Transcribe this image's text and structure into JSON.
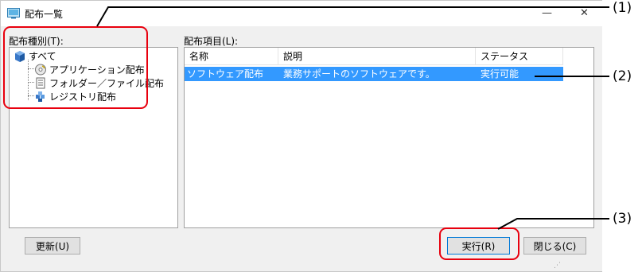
{
  "window": {
    "title": "配布一覧",
    "minimize_glyph": "—",
    "close_glyph": "✕"
  },
  "left_panel": {
    "label": "配布種別(T):",
    "tree": [
      {
        "label": "すべて",
        "icon": "all-distributions-icon"
      },
      {
        "label": "アプリケーション配布",
        "icon": "application-disc-icon"
      },
      {
        "label": "フォルダー／ファイル配布",
        "icon": "folder-file-icon"
      },
      {
        "label": "レジストリ配布",
        "icon": "registry-icon"
      }
    ]
  },
  "right_panel": {
    "label": "配布項目(L):",
    "columns": [
      "名称",
      "説明",
      "ステータス"
    ],
    "rows": [
      {
        "name": "ソフトウェア配布",
        "description": "業務サポートのソフトウェアです。",
        "status": "実行可能"
      }
    ]
  },
  "buttons": {
    "refresh": "更新(U)",
    "execute": "実行(R)",
    "close": "閉じる(C)"
  },
  "annotations": {
    "marker1": "(1)",
    "marker2": "(2)",
    "marker3": "(3)"
  },
  "colors": {
    "selection": "#3399ff",
    "callout": "#e8000e",
    "window_bg": "#f0f0f0"
  }
}
